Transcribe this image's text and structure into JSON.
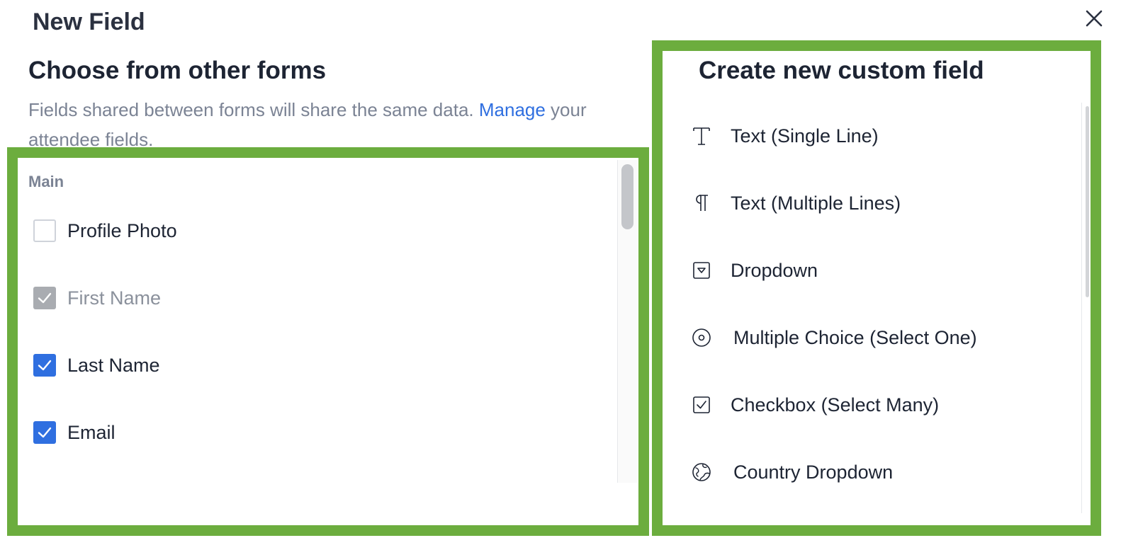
{
  "dialog": {
    "title": "New Field",
    "close_icon": "close-icon"
  },
  "left_panel": {
    "heading": "Choose from other forms",
    "description_before": "Fields shared between forms will share the same data. ",
    "manage_link": "Manage",
    "description_after": " your attendee fields.",
    "section_label": "Main",
    "fields": [
      {
        "label": "Profile Photo",
        "state": "unchecked"
      },
      {
        "label": "First Name",
        "state": "checked-disabled"
      },
      {
        "label": "Last Name",
        "state": "checked"
      },
      {
        "label": "Email",
        "state": "checked"
      }
    ]
  },
  "right_panel": {
    "heading": "Create new custom field",
    "types": [
      {
        "label": "Text (Single Line)",
        "icon": "text-icon"
      },
      {
        "label": "Text (Multiple Lines)",
        "icon": "paragraph-icon"
      },
      {
        "label": "Dropdown",
        "icon": "dropdown-icon"
      },
      {
        "label": "Multiple Choice (Select One)",
        "icon": "radio-icon"
      },
      {
        "label": "Checkbox (Select Many)",
        "icon": "checkbox-icon"
      },
      {
        "label": "Country Dropdown",
        "icon": "globe-icon"
      }
    ]
  },
  "colors": {
    "highlight": "#6cad3e",
    "link": "#2f6fe0",
    "checkbox_checked": "#2f6fe0",
    "checkbox_disabled": "#a9acb1"
  }
}
